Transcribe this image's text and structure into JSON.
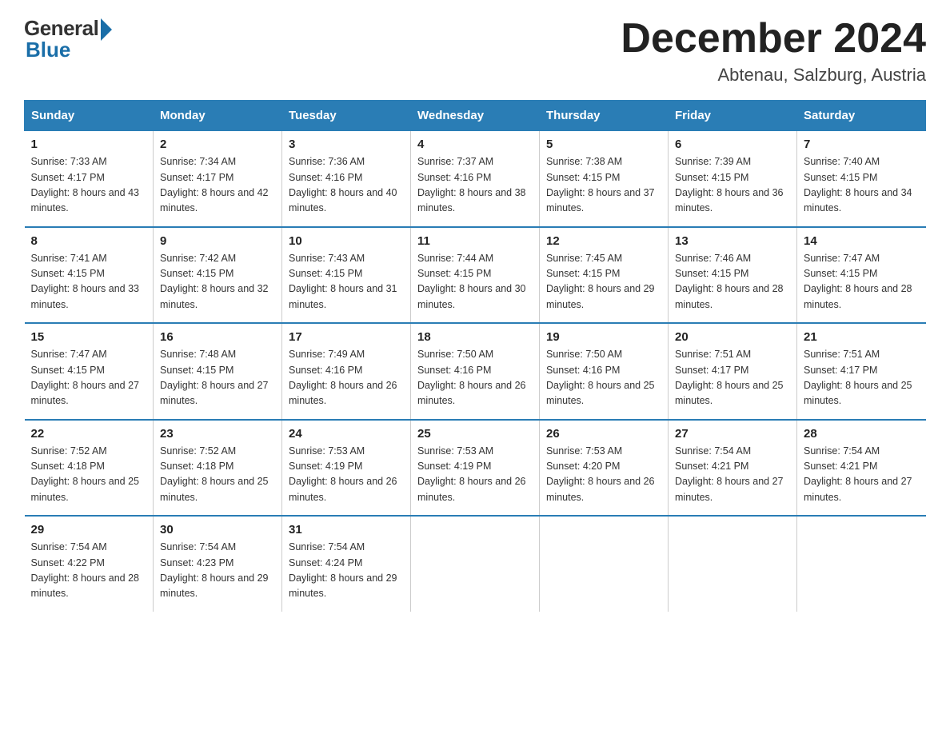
{
  "logo": {
    "general": "General",
    "blue": "Blue"
  },
  "title": "December 2024",
  "location": "Abtenau, Salzburg, Austria",
  "days_of_week": [
    "Sunday",
    "Monday",
    "Tuesday",
    "Wednesday",
    "Thursday",
    "Friday",
    "Saturday"
  ],
  "weeks": [
    [
      {
        "num": "1",
        "sunrise": "7:33 AM",
        "sunset": "4:17 PM",
        "daylight": "8 hours and 43 minutes."
      },
      {
        "num": "2",
        "sunrise": "7:34 AM",
        "sunset": "4:17 PM",
        "daylight": "8 hours and 42 minutes."
      },
      {
        "num": "3",
        "sunrise": "7:36 AM",
        "sunset": "4:16 PM",
        "daylight": "8 hours and 40 minutes."
      },
      {
        "num": "4",
        "sunrise": "7:37 AM",
        "sunset": "4:16 PM",
        "daylight": "8 hours and 38 minutes."
      },
      {
        "num": "5",
        "sunrise": "7:38 AM",
        "sunset": "4:15 PM",
        "daylight": "8 hours and 37 minutes."
      },
      {
        "num": "6",
        "sunrise": "7:39 AM",
        "sunset": "4:15 PM",
        "daylight": "8 hours and 36 minutes."
      },
      {
        "num": "7",
        "sunrise": "7:40 AM",
        "sunset": "4:15 PM",
        "daylight": "8 hours and 34 minutes."
      }
    ],
    [
      {
        "num": "8",
        "sunrise": "7:41 AM",
        "sunset": "4:15 PM",
        "daylight": "8 hours and 33 minutes."
      },
      {
        "num": "9",
        "sunrise": "7:42 AM",
        "sunset": "4:15 PM",
        "daylight": "8 hours and 32 minutes."
      },
      {
        "num": "10",
        "sunrise": "7:43 AM",
        "sunset": "4:15 PM",
        "daylight": "8 hours and 31 minutes."
      },
      {
        "num": "11",
        "sunrise": "7:44 AM",
        "sunset": "4:15 PM",
        "daylight": "8 hours and 30 minutes."
      },
      {
        "num": "12",
        "sunrise": "7:45 AM",
        "sunset": "4:15 PM",
        "daylight": "8 hours and 29 minutes."
      },
      {
        "num": "13",
        "sunrise": "7:46 AM",
        "sunset": "4:15 PM",
        "daylight": "8 hours and 28 minutes."
      },
      {
        "num": "14",
        "sunrise": "7:47 AM",
        "sunset": "4:15 PM",
        "daylight": "8 hours and 28 minutes."
      }
    ],
    [
      {
        "num": "15",
        "sunrise": "7:47 AM",
        "sunset": "4:15 PM",
        "daylight": "8 hours and 27 minutes."
      },
      {
        "num": "16",
        "sunrise": "7:48 AM",
        "sunset": "4:15 PM",
        "daylight": "8 hours and 27 minutes."
      },
      {
        "num": "17",
        "sunrise": "7:49 AM",
        "sunset": "4:16 PM",
        "daylight": "8 hours and 26 minutes."
      },
      {
        "num": "18",
        "sunrise": "7:50 AM",
        "sunset": "4:16 PM",
        "daylight": "8 hours and 26 minutes."
      },
      {
        "num": "19",
        "sunrise": "7:50 AM",
        "sunset": "4:16 PM",
        "daylight": "8 hours and 25 minutes."
      },
      {
        "num": "20",
        "sunrise": "7:51 AM",
        "sunset": "4:17 PM",
        "daylight": "8 hours and 25 minutes."
      },
      {
        "num": "21",
        "sunrise": "7:51 AM",
        "sunset": "4:17 PM",
        "daylight": "8 hours and 25 minutes."
      }
    ],
    [
      {
        "num": "22",
        "sunrise": "7:52 AM",
        "sunset": "4:18 PM",
        "daylight": "8 hours and 25 minutes."
      },
      {
        "num": "23",
        "sunrise": "7:52 AM",
        "sunset": "4:18 PM",
        "daylight": "8 hours and 25 minutes."
      },
      {
        "num": "24",
        "sunrise": "7:53 AM",
        "sunset": "4:19 PM",
        "daylight": "8 hours and 26 minutes."
      },
      {
        "num": "25",
        "sunrise": "7:53 AM",
        "sunset": "4:19 PM",
        "daylight": "8 hours and 26 minutes."
      },
      {
        "num": "26",
        "sunrise": "7:53 AM",
        "sunset": "4:20 PM",
        "daylight": "8 hours and 26 minutes."
      },
      {
        "num": "27",
        "sunrise": "7:54 AM",
        "sunset": "4:21 PM",
        "daylight": "8 hours and 27 minutes."
      },
      {
        "num": "28",
        "sunrise": "7:54 AM",
        "sunset": "4:21 PM",
        "daylight": "8 hours and 27 minutes."
      }
    ],
    [
      {
        "num": "29",
        "sunrise": "7:54 AM",
        "sunset": "4:22 PM",
        "daylight": "8 hours and 28 minutes."
      },
      {
        "num": "30",
        "sunrise": "7:54 AM",
        "sunset": "4:23 PM",
        "daylight": "8 hours and 29 minutes."
      },
      {
        "num": "31",
        "sunrise": "7:54 AM",
        "sunset": "4:24 PM",
        "daylight": "8 hours and 29 minutes."
      },
      null,
      null,
      null,
      null
    ]
  ]
}
